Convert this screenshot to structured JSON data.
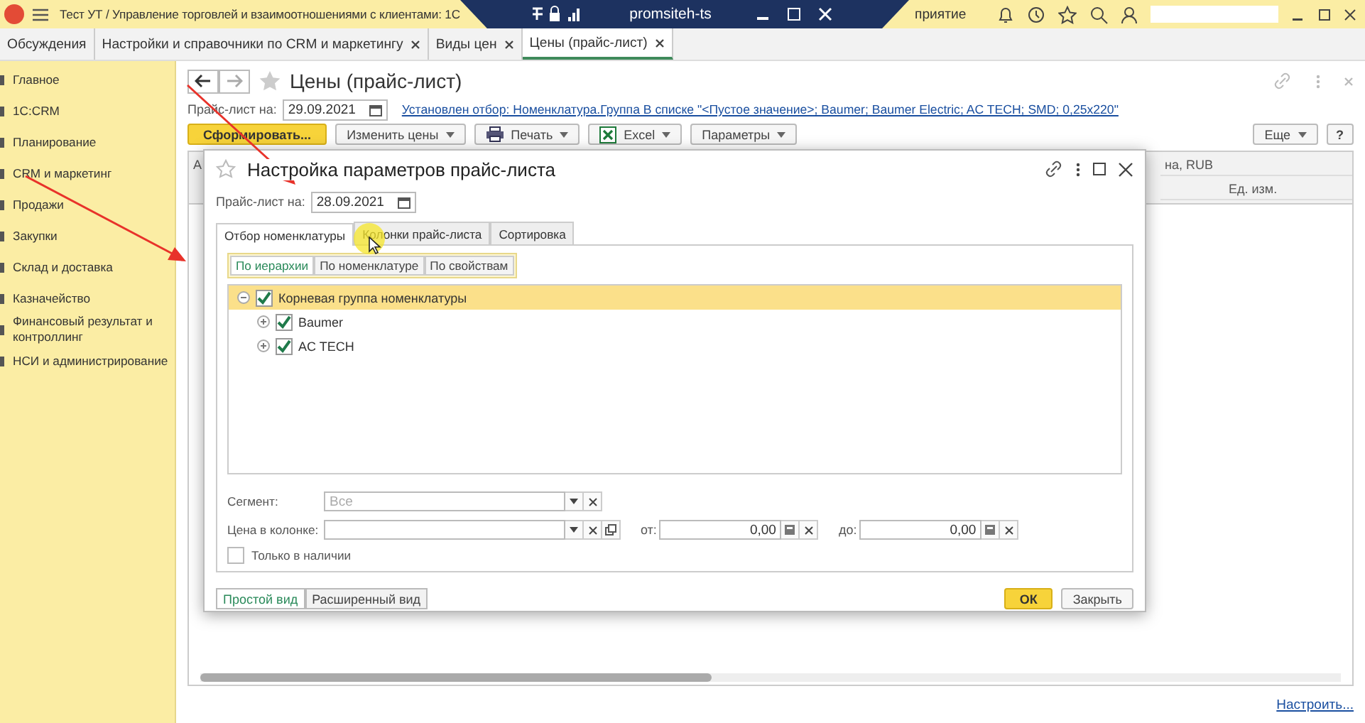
{
  "app_title": "Тест УТ / Управление торговлей и взаимоотношениями с клиентами: 1С",
  "remote_bar": {
    "host": "promsiteh-ts"
  },
  "title_tail": "приятие",
  "open_tabs": [
    {
      "label": "Обсуждения",
      "closable": false,
      "selected": false
    },
    {
      "label": "Настройки и справочники по CRM и маркетингу",
      "closable": true,
      "selected": false
    },
    {
      "label": "Виды цен",
      "closable": true,
      "selected": false
    },
    {
      "label": "Цены (прайс-лист)",
      "closable": true,
      "selected": true
    }
  ],
  "sidebar": [
    {
      "label": "Главное"
    },
    {
      "label": "1С:CRM"
    },
    {
      "label": "Планирование"
    },
    {
      "label": "CRM и маркетинг"
    },
    {
      "label": "Продажи"
    },
    {
      "label": "Закупки"
    },
    {
      "label": "Склад и доставка"
    },
    {
      "label": "Казначейство"
    },
    {
      "label": "Финансовый результат и контроллинг"
    },
    {
      "label": "НСИ и администрирование"
    }
  ],
  "page": {
    "title": "Цены (прайс-лист)",
    "date_label": "Прайс-лист на:",
    "date_value": "29.09.2021",
    "filter_link": "Установлен отбор: Номенклатура.Группа В списке \"<Пустое значение>; Baumer; Baumer Electric; AC TECH; SMD; 0,25х220\"",
    "buttons": [
      {
        "label": "Сформировать...",
        "kind": "primary"
      },
      {
        "label": "Изменить цены",
        "kind": "dropdown"
      },
      {
        "label": "Печать",
        "kind": "print"
      },
      {
        "label": "Excel",
        "kind": "excel"
      },
      {
        "label": "Параметры",
        "kind": "dropdown"
      }
    ],
    "more": "Еще",
    "help": "?",
    "columns": [
      "А",
      "на, RUB",
      "Ед. изм."
    ],
    "footer_link": "Настроить..."
  },
  "dialog": {
    "title": "Настройка параметров прайс-листа",
    "date_label": "Прайс-лист на:",
    "date_value": "28.09.2021",
    "tabs": [
      {
        "label": "Отбор номенклатуры",
        "selected": true
      },
      {
        "label": "Колонки прайс-листа",
        "selected": false
      },
      {
        "label": "Сортировка",
        "selected": false
      }
    ],
    "subtabs": [
      {
        "label": "По иерархии",
        "selected": true
      },
      {
        "label": "По номенклатуре",
        "selected": false
      },
      {
        "label": "По свойствам",
        "selected": false
      }
    ],
    "tree": [
      {
        "label": "Корневая группа номенклатуры",
        "checked": true,
        "selected": true,
        "expanded": true,
        "children": [
          {
            "label": "Baumer",
            "checked": true,
            "selected": false,
            "expanded": false
          },
          {
            "label": "AC TECH",
            "checked": true,
            "selected": false,
            "expanded": false
          }
        ]
      }
    ],
    "segment": {
      "label": "Сегмент:",
      "placeholder": "Все"
    },
    "price_column": {
      "label": "Цена в колонке:"
    },
    "from": {
      "label": "от:",
      "value": "0,00"
    },
    "to": {
      "label": "до:",
      "value": "0,00"
    },
    "in_stock": {
      "label": "Только в наличии",
      "checked": false
    },
    "view_buttons": [
      {
        "label": "Простой вид",
        "selected": true
      },
      {
        "label": "Расширенный вид",
        "selected": false
      }
    ],
    "ok": "ОК",
    "close": "Закрыть"
  }
}
